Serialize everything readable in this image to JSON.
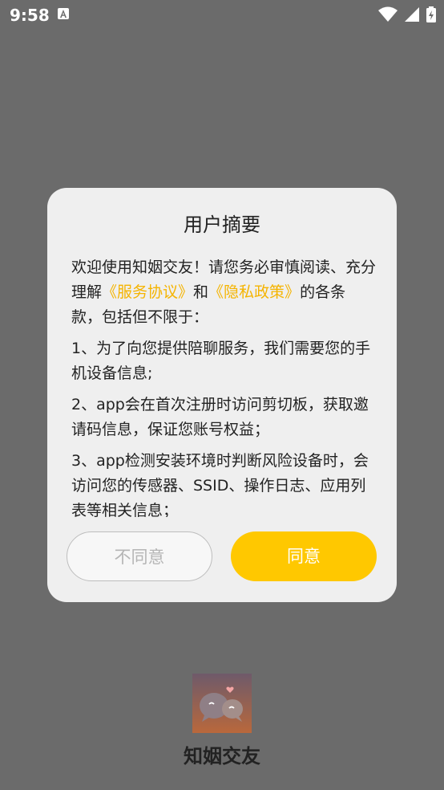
{
  "status_bar": {
    "time": "9:58",
    "notification_icon": "a-notification-icon",
    "icons": [
      "wifi-icon",
      "cellular-icon",
      "battery-charging-icon"
    ]
  },
  "dialog": {
    "title": "用户摘要",
    "intro_before": "欢迎使用知姻交友！请您务必审慎阅读、充分理解",
    "service_link": "《服务协议》",
    "and_word": "和",
    "privacy_link": "《隐私政策》",
    "intro_after": "的各条款，包括但不限于：",
    "items": [
      "1、为了向您提供陪聊服务，我们需要您的手机设备信息;",
      "2、app会在首次注册时访问剪切板，获取邀请码信息，保证您账号权益；",
      "3、app检测安装环境时判断风险设备时，会访问您的传感器、SSID、操作日志、应用列表等相关信息；"
    ],
    "disagree_label": "不同意",
    "agree_label": "同意"
  },
  "app": {
    "logo_icon": "chat-bubbles-logo-icon",
    "name": "知姻交友"
  },
  "colors": {
    "overlay_bg": "#6b6b6b",
    "accent": "#ffc800",
    "link": "#f5b400"
  }
}
